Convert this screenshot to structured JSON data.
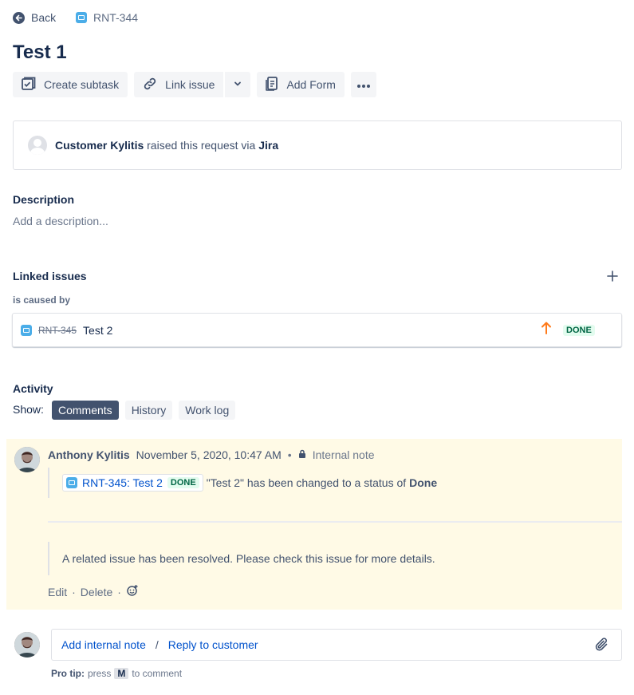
{
  "nav": {
    "back_label": "Back",
    "issue_key": "RNT-344"
  },
  "issue": {
    "title": "Test 1"
  },
  "toolbar": {
    "create_subtask": "Create subtask",
    "link_issue": "Link issue",
    "add_form": "Add Form"
  },
  "request": {
    "customer": "Customer Kylitis",
    "middle_text": " raised this request via ",
    "channel": "Jira"
  },
  "description": {
    "heading": "Description",
    "placeholder": "Add a description..."
  },
  "linked": {
    "heading": "Linked issues",
    "relation": "is caused by",
    "items": [
      {
        "key": "RNT-345",
        "title": "Test 2",
        "status": "DONE"
      }
    ]
  },
  "activity": {
    "heading": "Activity",
    "show_label": "Show:",
    "tabs": [
      "Comments",
      "History",
      "Work log"
    ],
    "active_tab": "Comments"
  },
  "comment": {
    "author": "Anthony Kylitis",
    "timestamp": "November 5, 2020, 10:47 AM",
    "separator": "•",
    "visibility": "Internal note",
    "linked_chip": "RNT-345: Test 2",
    "chip_status": "DONE",
    "change_text": "\"Test 2\" has been changed to a status of ",
    "new_status": "Done",
    "body": "A related issue has been resolved. Please check this issue for more details.",
    "edit": "Edit",
    "delete": "Delete",
    "action_separator": "·"
  },
  "reply": {
    "internal_note": "Add internal note",
    "slash": "/",
    "reply_customer": "Reply to customer",
    "protip_label": "Pro tip:",
    "protip_press": "press",
    "protip_key": "M",
    "protip_suffix": "to comment"
  },
  "colors": {
    "accent": "#0052cc",
    "done_bg": "#e3fcef",
    "done_text": "#006644",
    "note_bg": "#fffae6",
    "priority_arrow": "#ff7a1a"
  }
}
